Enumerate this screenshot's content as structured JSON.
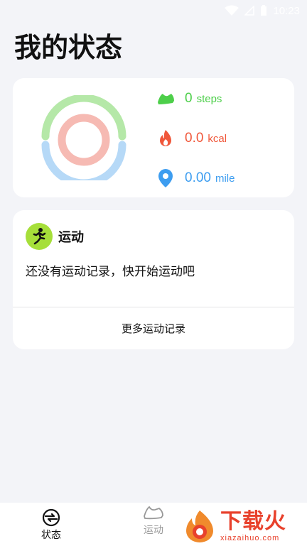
{
  "status_bar": {
    "time": "10:23"
  },
  "page_title": "我的状态",
  "stats": {
    "steps": {
      "value": "0",
      "unit": "steps"
    },
    "kcal": {
      "value": "0.0",
      "unit": "kcal"
    },
    "mile": {
      "value": "0.00",
      "unit": "mile"
    }
  },
  "exercise": {
    "title": "运动",
    "empty_text": "还没有运动记录，快开始运动吧",
    "more_label": "更多运动记录"
  },
  "bottom_nav": {
    "status_label": "状态",
    "sport_label": "运动"
  },
  "watermark": {
    "cn": "下载火",
    "en": "xiazaihuo.com"
  },
  "colors": {
    "steps": "#4dcf4a",
    "kcal": "#f0573a",
    "mile": "#3d9df0",
    "ring_green": "#b5e8a8",
    "ring_red": "#f6bab3",
    "ring_blue": "#b6d9f7"
  }
}
